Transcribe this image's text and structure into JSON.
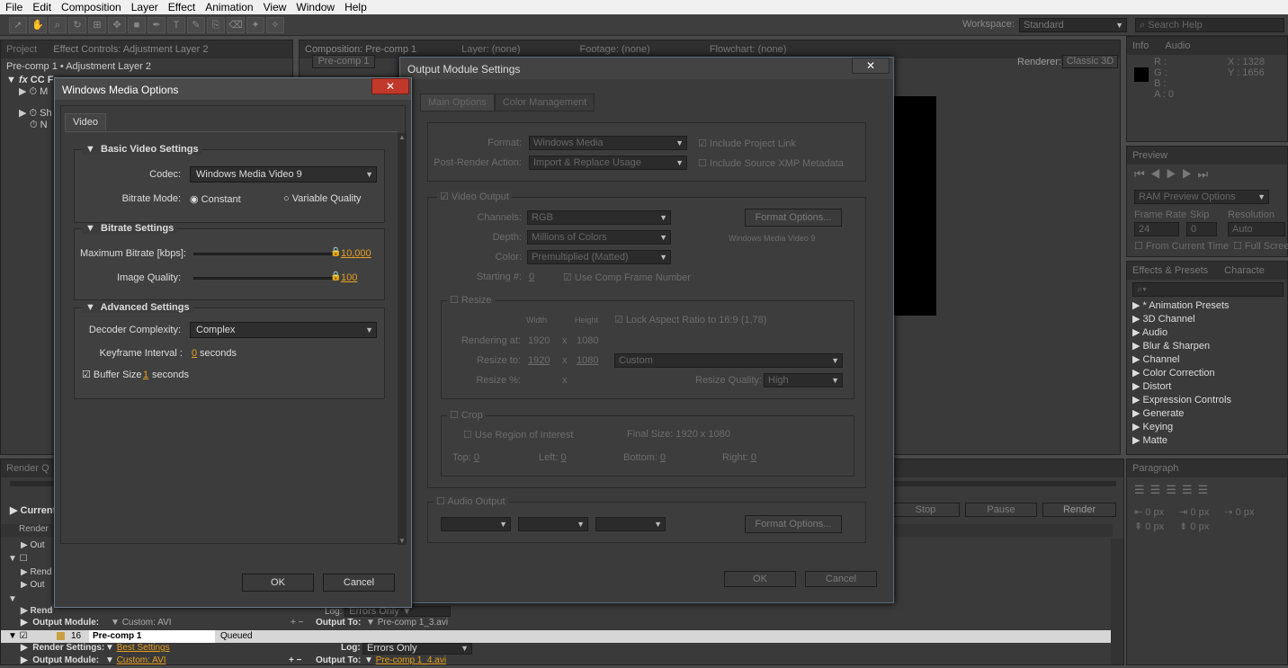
{
  "menu": [
    "File",
    "Edit",
    "Composition",
    "Layer",
    "Effect",
    "Animation",
    "View",
    "Window",
    "Help"
  ],
  "toolbar": {
    "workspace_label": "Workspace:",
    "workspace_value": "Standard",
    "search_placeholder": "Search Help"
  },
  "left_panel": {
    "tab_project": "Project",
    "tab_effect_controls": "Effect Controls: Adjustment Layer 2",
    "breadcrumb": "Pre-comp 1 • Adjustment Layer 2",
    "fx_label": "CC Fo",
    "row_m": "M",
    "row_sh": "Sh",
    "row_n": "N"
  },
  "comp_panel": {
    "tab_composition": "Composition: Pre-comp 1",
    "tab_layer": "Layer: (none)",
    "tab_footage": "Footage: (none)",
    "tab_flowchart": "Flowchart: (none)",
    "subtab": "Pre-comp 1",
    "renderer_label": "Renderer:",
    "renderer_value": "Classic 3D"
  },
  "info_panel": {
    "tab_info": "Info",
    "tab_audio": "Audio",
    "r": "R :",
    "g": "G :",
    "b": "B :",
    "a": "A : 0",
    "x": "X : 1328",
    "y": "Y : 1656"
  },
  "preview_panel": {
    "tab": "Preview",
    "ram_options": "RAM Preview Options",
    "frame_rate": "Frame Rate",
    "skip": "Skip",
    "resolution": "Resolution",
    "fps": "24",
    "skip_val": "0",
    "res_val": "Auto",
    "from_current": "From Current Time",
    "full_screen": "Full Screen"
  },
  "effects_panel": {
    "tab": "Effects & Presets",
    "tab2": "Characte",
    "items": [
      "* Animation Presets",
      "3D Channel",
      "Audio",
      "Blur & Sharpen",
      "Channel",
      "Color Correction",
      "Distort",
      "Expression Controls",
      "Generate",
      "Keying",
      "Matte"
    ]
  },
  "paragraph_panel": {
    "tab": "Paragraph",
    "v1": "0 px",
    "v2": "0 px",
    "v3": "0 px",
    "v4": "0 px",
    "v5": "0 px"
  },
  "render_queue": {
    "tab": "Render Q",
    "current": "Current",
    "render_col": "Render",
    "stop": "Stop",
    "pause": "Pause",
    "render_btn": "Render",
    "row_render_settings_label": "Render Settings:",
    "row_output_module_label": "Output Module:",
    "row_log_label": "Log:",
    "row_output_to_label": "Output To:",
    "item15_output_module": "Custom: AVI",
    "item15_log": "Errors Only",
    "item15_output_to": "Pre-comp 1_3.avi",
    "item16_num": "16",
    "item16_name": "Pre-comp 1",
    "item16_status": "Queued",
    "item16_render_settings": "Best Settings",
    "item16_log": "Errors Only",
    "item16_output_module": "Custom: AVI",
    "item16_output_to": "Pre-comp 1_4.avi",
    "short_render": "Rend",
    "short_output": "Out"
  },
  "output_module": {
    "title": "Output Module Settings",
    "tab_main": "Main Options",
    "tab_color": "Color Management",
    "format_label": "Format:",
    "format_value": "Windows Media",
    "include_project_link": "Include Project Link",
    "post_render_label": "Post-Render Action:",
    "post_render_value": "Import & Replace Usage",
    "include_xmp": "Include Source XMP Metadata",
    "video_output": "Video Output",
    "channels_label": "Channels:",
    "channels_value": "RGB",
    "format_options": "Format Options...",
    "depth_label": "Depth:",
    "depth_value": "Millions of Colors",
    "codec_info": "Windows Media Video 9",
    "color_label": "Color:",
    "color_value": "Premultiplied (Matted)",
    "starting_label": "Starting #:",
    "starting_value": "0",
    "use_comp_frame": "Use Comp Frame Number",
    "resize": "Resize",
    "width": "Width",
    "height": "Height",
    "lock_aspect": "Lock Aspect Ratio to 16:9 (1,78)",
    "rendering_at": "Rendering at:",
    "rw": "1920",
    "rh": "1080",
    "x": "x",
    "resize_to": "Resize to:",
    "tw": "1920",
    "th": "1080",
    "custom": "Custom",
    "resize_pct": "Resize %:",
    "resize_quality": "Resize Quality:",
    "quality_value": "High",
    "crop": "Crop",
    "use_roi": "Use Region of Interest",
    "final_size": "Final Size: 1920 x 1080",
    "top": "Top:",
    "left": "Left:",
    "bottom": "Bottom:",
    "right": "Right:",
    "zero": "0",
    "audio_output": "Audio Output",
    "format_options2": "Format Options...",
    "ok": "OK",
    "cancel": "Cancel"
  },
  "wm_dialog": {
    "title": "Windows Media Options",
    "tab": "Video",
    "basic": "Basic Video Settings",
    "codec_label": "Codec:",
    "codec_value": "Windows Media Video 9",
    "bitrate_mode_label": "Bitrate Mode:",
    "constant": "Constant",
    "variable": "Variable Quality",
    "bitrate_settings": "Bitrate Settings",
    "max_bitrate_label": "Maximum Bitrate [kbps]:",
    "max_bitrate_value": "10,000",
    "image_quality_label": "Image Quality:",
    "image_quality_value": "100",
    "advanced": "Advanced Settings",
    "decoder_label": "Decoder Complexity:",
    "decoder_value": "Complex",
    "keyframe_label": "Keyframe Interval :",
    "keyframe_value": "0",
    "seconds": "seconds",
    "buffer_label": "Buffer Size",
    "buffer_value": "1",
    "seconds2": "seconds",
    "ok": "OK",
    "cancel": "Cancel"
  }
}
